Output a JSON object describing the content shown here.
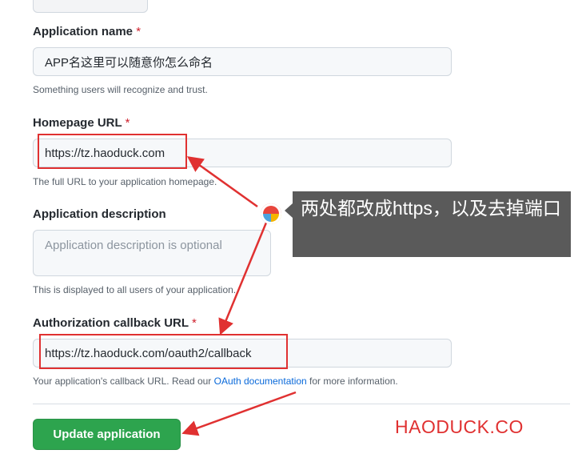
{
  "form": {
    "app_name": {
      "label": "Application name",
      "required_mark": "*",
      "value": "APP名这里可以随意你怎么命名",
      "note": "Something users will recognize and trust."
    },
    "homepage": {
      "label": "Homepage URL",
      "required_mark": "*",
      "value": "https://tz.haoduck.com",
      "note": "The full URL to your application homepage."
    },
    "description": {
      "label": "Application description",
      "placeholder": "Application description is optional",
      "note": "This is displayed to all users of your application."
    },
    "callback": {
      "label": "Authorization callback URL",
      "required_mark": "*",
      "value": "https://tz.haoduck.com/oauth2/callback",
      "note_before": "Your application's callback URL. Read our ",
      "note_link": "OAuth documentation",
      "note_after": " for more information."
    },
    "submit_label": "Update application"
  },
  "annotation": {
    "callout_text": "两处都改成https，以及去掉端口",
    "watermark": "HAODUCK.CO",
    "box_color": "#e03131"
  }
}
